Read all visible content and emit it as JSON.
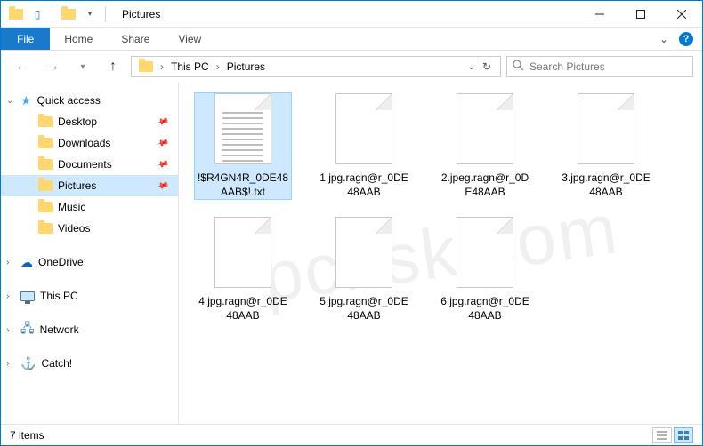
{
  "window": {
    "title": "Pictures"
  },
  "ribbon": {
    "file": "File",
    "tabs": [
      "Home",
      "Share",
      "View"
    ]
  },
  "breadcrumb": {
    "segments": [
      "This PC",
      "Pictures"
    ]
  },
  "search": {
    "placeholder": "Search Pictures"
  },
  "nav": {
    "quick_access": {
      "label": "Quick access",
      "items": [
        {
          "label": "Desktop",
          "pinned": true
        },
        {
          "label": "Downloads",
          "pinned": true
        },
        {
          "label": "Documents",
          "pinned": true
        },
        {
          "label": "Pictures",
          "pinned": true,
          "selected": true
        },
        {
          "label": "Music",
          "pinned": false
        },
        {
          "label": "Videos",
          "pinned": false
        }
      ]
    },
    "roots": [
      {
        "label": "OneDrive",
        "icon": "cloud"
      },
      {
        "label": "This PC",
        "icon": "monitor"
      },
      {
        "label": "Network",
        "icon": "network"
      },
      {
        "label": "Catch!",
        "icon": "hook"
      }
    ]
  },
  "files": [
    {
      "name": "!$R4GN4R_0DE48AAB$!.txt",
      "type": "txt",
      "selected": true
    },
    {
      "name": "1.jpg.ragn@r_0DE48AAB",
      "type": "blank"
    },
    {
      "name": "2.jpeg.ragn@r_0DE48AAB",
      "type": "blank"
    },
    {
      "name": "3.jpg.ragn@r_0DE48AAB",
      "type": "blank"
    },
    {
      "name": "4.jpg.ragn@r_0DE48AAB",
      "type": "blank"
    },
    {
      "name": "5.jpg.ragn@r_0DE48AAB",
      "type": "blank"
    },
    {
      "name": "6.jpg.ragn@r_0DE48AAB",
      "type": "blank"
    }
  ],
  "status": {
    "text": "7 items"
  },
  "watermark": "pcrisk.com"
}
